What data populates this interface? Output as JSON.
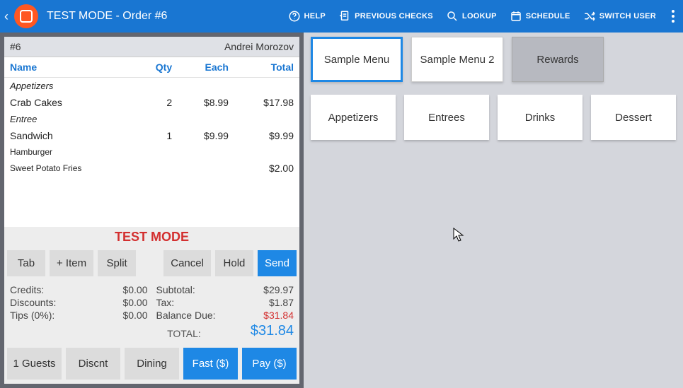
{
  "header": {
    "title": "TEST MODE - Order #6",
    "actions": {
      "help": "HELP",
      "previous_checks": "PREVIOUS CHECKS",
      "lookup": "LOOKUP",
      "schedule": "SCHEDULE",
      "switch_user": "SWITCH USER"
    }
  },
  "order": {
    "number_label": "#6",
    "server": "Andrei Morozov",
    "columns": {
      "name": "Name",
      "qty": "Qty",
      "each": "Each",
      "total": "Total"
    },
    "sections": [
      {
        "label": "Appetizers",
        "items": [
          {
            "name": "Crab Cakes",
            "qty": "2",
            "each": "$8.99",
            "total": "$17.98",
            "mods": []
          }
        ]
      },
      {
        "label": "Entree",
        "items": [
          {
            "name": "Sandwich",
            "qty": "1",
            "each": "$9.99",
            "total": "$9.99",
            "mods": [
              {
                "name": "Hamburger",
                "total": ""
              },
              {
                "name": "Sweet Potato Fries",
                "total": "$2.00"
              }
            ]
          }
        ]
      }
    ]
  },
  "controls": {
    "test_mode": "TEST MODE",
    "row1": {
      "tab": "Tab",
      "add_item": "+ Item",
      "split": "Split",
      "cancel": "Cancel",
      "hold": "Hold",
      "send": "Send"
    },
    "totals_left": {
      "credits_label": "Credits:",
      "credits_val": "$0.00",
      "discounts_label": "Discounts:",
      "discounts_val": "$0.00",
      "tips_label": "Tips (0%):",
      "tips_val": "$0.00"
    },
    "totals_right": {
      "subtotal_label": "Subtotal:",
      "subtotal_val": "$29.97",
      "tax_label": "Tax:",
      "tax_val": "$1.87",
      "balance_label": "Balance Due:",
      "balance_val": "$31.84",
      "total_label": "TOTAL:",
      "total_val": "$31.84"
    },
    "footer": {
      "guests": "1 Guests",
      "discnt": "Discnt",
      "dining": "Dining",
      "fast": "Fast ($)",
      "pay": "Pay ($)"
    }
  },
  "menus": {
    "tabs": [
      {
        "label": "Sample Menu",
        "active": true
      },
      {
        "label": "Sample Menu 2",
        "active": false
      },
      {
        "label": "Rewards",
        "rewards": true
      }
    ],
    "categories": [
      "Appetizers",
      "Entrees",
      "Drinks",
      "Dessert"
    ]
  }
}
